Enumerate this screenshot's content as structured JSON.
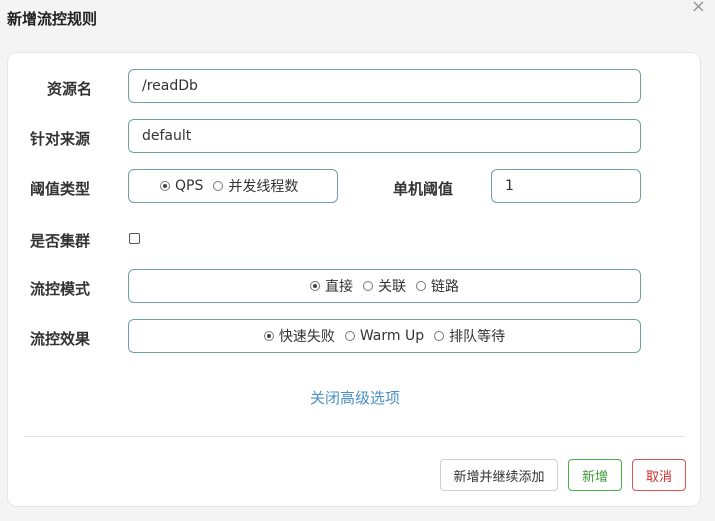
{
  "dialog": {
    "title": "新增流控规则",
    "close_label": "×"
  },
  "form": {
    "resource": {
      "label": "资源名",
      "value": "/readDb"
    },
    "limit_app": {
      "label": "针对来源",
      "value": "default"
    },
    "grade": {
      "label": "阈值类型",
      "options": [
        {
          "label": "QPS",
          "selected": true
        },
        {
          "label": "并发线程数",
          "selected": false
        }
      ]
    },
    "count": {
      "label": "单机阈值",
      "value": "1"
    },
    "cluster": {
      "label": "是否集群",
      "checked": false
    },
    "strategy": {
      "label": "流控模式",
      "options": [
        {
          "label": "直接",
          "selected": true
        },
        {
          "label": "关联",
          "selected": false
        },
        {
          "label": "链路",
          "selected": false
        }
      ]
    },
    "control_behavior": {
      "label": "流控效果",
      "options": [
        {
          "label": "快速失败",
          "selected": true
        },
        {
          "label": "Warm Up",
          "selected": false
        },
        {
          "label": "排队等待",
          "selected": false
        }
      ]
    },
    "advanced_toggle": "关闭高级选项"
  },
  "footer": {
    "add_continue_label": "新增并继续添加",
    "add_label": "新增",
    "cancel_label": "取消"
  }
}
